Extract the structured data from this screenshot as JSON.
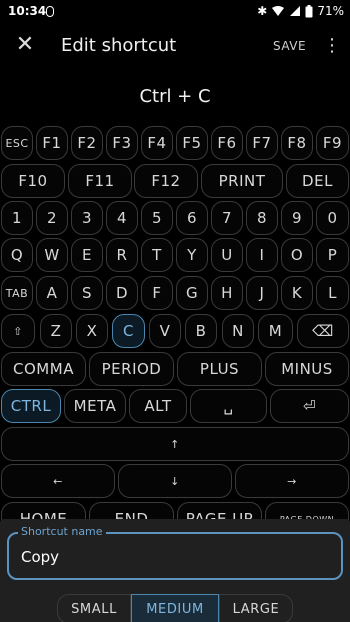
{
  "status_bar": {
    "time": "10:34",
    "battery": "71%"
  },
  "app_bar": {
    "title": "Edit shortcut",
    "save_label": "SAVE"
  },
  "shortcut_preview": "Ctrl + C",
  "keyboard": {
    "row1": [
      "ESC",
      "F1",
      "F2",
      "F3",
      "F4",
      "F5",
      "F6",
      "F7",
      "F8",
      "F9"
    ],
    "row2": [
      "F10",
      "F11",
      "F12",
      "PRINT",
      "DEL"
    ],
    "row3": [
      "1",
      "2",
      "3",
      "4",
      "5",
      "6",
      "7",
      "8",
      "9",
      "0"
    ],
    "row4": [
      "Q",
      "W",
      "E",
      "R",
      "T",
      "Y",
      "U",
      "I",
      "O",
      "P"
    ],
    "row5": [
      "TAB",
      "A",
      "S",
      "D",
      "F",
      "G",
      "H",
      "J",
      "K",
      "L"
    ],
    "row6": [
      "⇧",
      "Z",
      "X",
      "C",
      "V",
      "B",
      "N",
      "M",
      "⌫"
    ],
    "row7": [
      "COMMA",
      "PERIOD",
      "PLUS",
      "MINUS"
    ],
    "row8": [
      "CTRL",
      "META",
      "ALT",
      "␣",
      "⏎"
    ],
    "row9": [
      "↑"
    ],
    "row10": [
      "←",
      "↓",
      "→"
    ],
    "row11": [
      "HOME",
      "END",
      "PAGE UP",
      "PAGE DOWN"
    ]
  },
  "selected_keys": [
    "CTRL",
    "C"
  ],
  "shortcut_name": {
    "label": "Shortcut name",
    "value": "Copy"
  },
  "size_options": [
    "SMALL",
    "MEDIUM",
    "LARGE"
  ],
  "selected_size": "MEDIUM"
}
